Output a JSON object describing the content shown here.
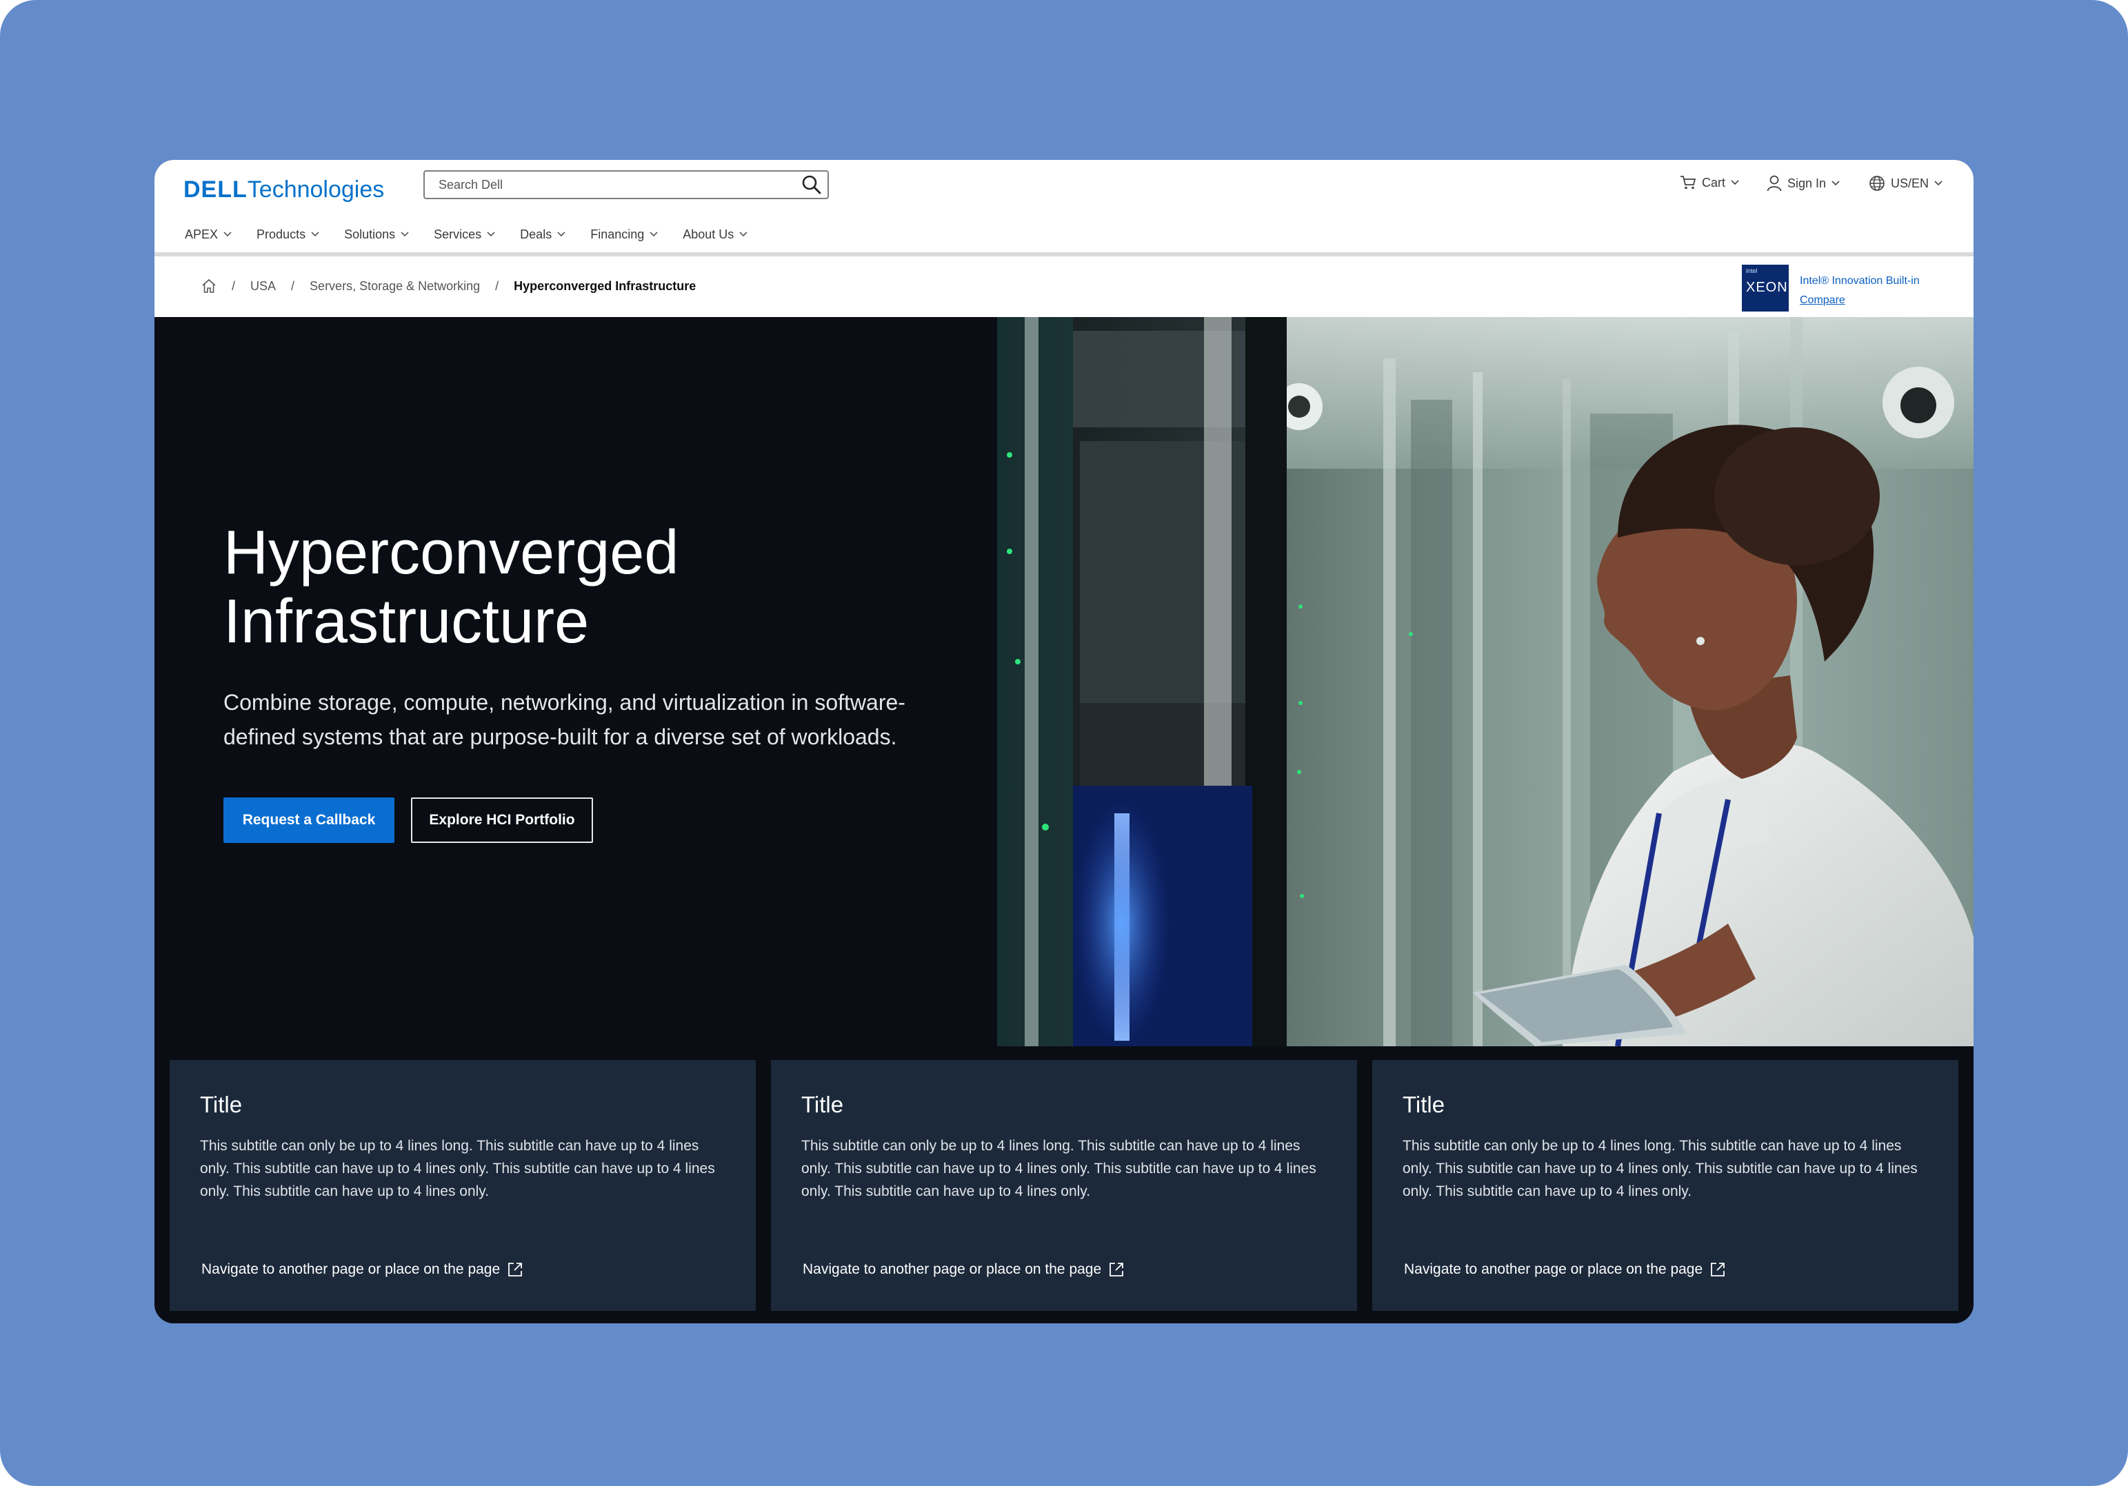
{
  "header": {
    "logo_brand": "DELL",
    "logo_suffix": "Technologies",
    "search_placeholder": "Search Dell",
    "cart_label": "Cart",
    "signin_label": "Sign In",
    "locale_label": "US/EN"
  },
  "nav": {
    "items": [
      {
        "label": "APEX"
      },
      {
        "label": "Products"
      },
      {
        "label": "Solutions"
      },
      {
        "label": "Services"
      },
      {
        "label": "Deals"
      },
      {
        "label": "Financing"
      },
      {
        "label": "About Us"
      }
    ]
  },
  "breadcrumb": {
    "items": [
      {
        "label": "USA"
      },
      {
        "label": "Servers, Storage & Networking"
      },
      {
        "label": "Hyperconverged Infrastructure"
      }
    ]
  },
  "intel": {
    "badge_top": "intel",
    "badge_main": "XEON",
    "title": "Intel® Innovation Built-in",
    "compare_label": "Compare"
  },
  "hero": {
    "title_line1": "Hyperconverged",
    "title_line2": "Infrastructure",
    "subtitle_line1": "Combine storage, compute, networking, and virtualization in software-",
    "subtitle_line2": "defined systems that are purpose-built for a diverse set of workloads.",
    "primary_cta": "Request a Callback",
    "secondary_cta": "Explore HCI Portfolio"
  },
  "cards": [
    {
      "title": "Title",
      "subtitle": "This subtitle can only be up to 4 lines long. This subtitle can have up to 4 lines only. This subtitle can have up to 4 lines only. This subtitle can have up to 4 lines only. This subtitle can have up to 4 lines only.",
      "link": "Navigate to another page or place on the page"
    },
    {
      "title": "Title",
      "subtitle": "This subtitle can only be up to 4 lines long. This subtitle can have up to 4 lines only. This subtitle can have up to 4 lines only. This subtitle can have up to 4 lines only. This subtitle can have up to 4 lines only.",
      "link": "Navigate to another page or place on the page"
    },
    {
      "title": "Title",
      "subtitle": "This subtitle can only be up to 4 lines long. This subtitle can have up to 4 lines only. This subtitle can have up to 4 lines only. This subtitle can have up to 4 lines only. This subtitle can have up to 4 lines only.",
      "link": "Navigate to another page or place on the page"
    }
  ],
  "colors": {
    "brand_blue": "#0672cb",
    "primary_button": "#0a6ed1",
    "hero_bg": "#0a0d14",
    "card_bg": "#1b293a",
    "backdrop": "#648bca"
  },
  "icons": {
    "search": "search-icon",
    "cart": "cart-icon",
    "user": "user-icon",
    "globe": "globe-icon",
    "home": "home-icon",
    "external": "external-link-icon"
  }
}
